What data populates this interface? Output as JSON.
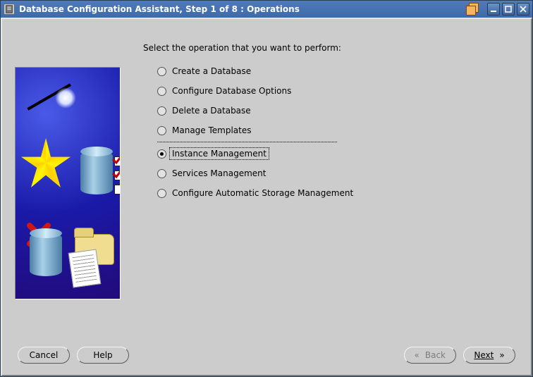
{
  "window": {
    "title": "Database Configuration Assistant, Step 1 of 8 : Operations"
  },
  "prompt": "Select the operation that you want to perform:",
  "options": [
    {
      "id": "create",
      "label": "Create a Database",
      "selected": false
    },
    {
      "id": "config",
      "label": "Configure Database Options",
      "selected": false
    },
    {
      "id": "delete",
      "label": "Delete a Database",
      "selected": false
    },
    {
      "id": "template",
      "label": "Manage Templates",
      "selected": false
    },
    {
      "id": "instance",
      "label": "Instance Management",
      "selected": true
    },
    {
      "id": "services",
      "label": "Services Management",
      "selected": false
    },
    {
      "id": "asm",
      "label": "Configure Automatic Storage Management",
      "selected": false
    }
  ],
  "separator_before_index": 4,
  "buttons": {
    "cancel": "Cancel",
    "help": "Help",
    "back": "Back",
    "next": "Next"
  },
  "nav_state": {
    "back_enabled": false,
    "next_enabled": true
  },
  "icons": {
    "minimize": "minimize-icon",
    "maximize": "maximize-icon",
    "close": "close-icon",
    "restore": "restore-icon",
    "app": "app-icon"
  }
}
